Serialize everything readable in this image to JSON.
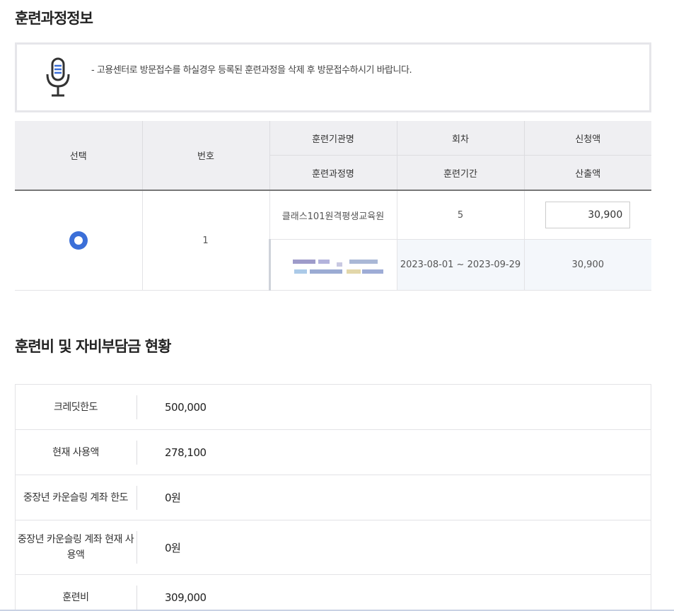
{
  "sections": {
    "course_info_title": "훈련과정정보",
    "cost_status_title": "훈련비 및 자비부담금 현황"
  },
  "notice": {
    "icon": "microphone-icon",
    "text": "- 고용센터로 방문접수를 하실경우 등록된 훈련과정을 삭제 후 방문접수하시기 바랍니다."
  },
  "course_table": {
    "headers": {
      "select": "선택",
      "number": "번호",
      "institution": "훈련기관명",
      "round": "회차",
      "request_amount": "신청액",
      "course_name": "훈련과정명",
      "period": "훈련기간",
      "calc_amount": "산출액"
    },
    "rows": [
      {
        "selected": true,
        "number": "1",
        "institution": "클래스101원격평생교육원",
        "round": "5",
        "request_amount": "30,900",
        "period": "2023-08-01 ~ 2023-09-29",
        "calc_amount": "30,900"
      }
    ]
  },
  "summary": [
    {
      "label": "크레딧한도",
      "value": "500,000"
    },
    {
      "label": "현재 사용액",
      "value": "278,100"
    },
    {
      "label": "중장년 카운슬링 계좌 한도",
      "value": "0원"
    },
    {
      "label": "중장년 카운슬링 계좌 현재 사용액",
      "value": "0원"
    },
    {
      "label": "훈련비",
      "value": "309,000"
    }
  ],
  "colors": {
    "radio_selected": "#3b6fd8",
    "header_bg": "#efeff2",
    "shaded_row_bg": "#f4f7fb"
  }
}
